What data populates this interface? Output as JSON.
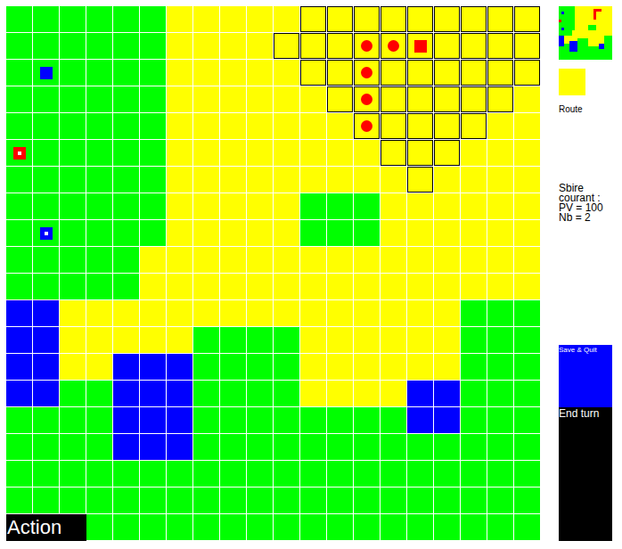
{
  "board": {
    "terrain_colors": {
      "G": "#00ff00",
      "Y": "#ffff00",
      "B": "#0000ff"
    },
    "rows": [
      "GGGGGGYYYYYYYYYYYYYY",
      "GGGGGGYYYYYYYYYYYYYY",
      "GGGGGGYYYYYYYYYYYYYY",
      "GGGGGGYYYYYYYYYYYYYY",
      "GGGGGGYYYYYYYYYYYYYY",
      "GGGGGGYYYYYYYYYYYYYY",
      "GGGGGGYYYYYYYYYYYYYY",
      "GGGGGGYYYYYGGGYYYYYY",
      "GGGGGGYYYYYGGGYYYYYY",
      "GGGGGYYYYYYYYYYYYYYY",
      "GGGGGYYYYYYYYYYYYYYY",
      "BBYYYYYYYYYYYYYYYGGG",
      "BBYYYYYGGGGYYYYYYGGG",
      "BBYYBBBGGGGYYYYYYGGG",
      "BBGGBBBGGGGYYYYBBGGG",
      "GGGGBBBGGGGGGGGBBGGG",
      "GGGGBBBGGGGGGGGGGGGG",
      "GGGGGGGGGGGGGGGGGGGG",
      "GGGGGGGGGGGGGGGGGGGG",
      "GGGGGGGGGGGGGGGGGGGG"
    ],
    "range": [
      {
        "row": 0,
        "from": 11,
        "to": 19
      },
      {
        "row": 1,
        "from": 10,
        "to": 19
      },
      {
        "row": 2,
        "from": 11,
        "to": 19
      },
      {
        "row": 3,
        "from": 12,
        "to": 18
      },
      {
        "row": 4,
        "from": 13,
        "to": 17
      },
      {
        "row": 5,
        "from": 14,
        "to": 16
      },
      {
        "row": 6,
        "from": 15,
        "to": 15
      }
    ],
    "units": [
      {
        "row": 2,
        "col": 1,
        "kind": "square",
        "color": "#0000ff",
        "marked": false
      },
      {
        "row": 5,
        "col": 0,
        "kind": "square",
        "color": "#ff0000",
        "marked": true
      },
      {
        "row": 8,
        "col": 1,
        "kind": "square",
        "color": "#0000ff",
        "marked": true
      },
      {
        "row": 1,
        "col": 13,
        "kind": "circle",
        "color": "#ff0000",
        "marked": false
      },
      {
        "row": 1,
        "col": 14,
        "kind": "circle",
        "color": "#ff0000",
        "marked": false
      },
      {
        "row": 1,
        "col": 15,
        "kind": "square",
        "color": "#ff0000",
        "marked": false
      },
      {
        "row": 2,
        "col": 13,
        "kind": "circle",
        "color": "#ff0000",
        "marked": false
      },
      {
        "row": 3,
        "col": 13,
        "kind": "circle",
        "color": "#ff0000",
        "marked": false
      },
      {
        "row": 4,
        "col": 13,
        "kind": "circle",
        "color": "#ff0000",
        "marked": false
      }
    ]
  },
  "action_button": "Action",
  "selected_terrain": {
    "label": "Route",
    "color": "#ffff00"
  },
  "unit_info": {
    "title": "Sbire courant :",
    "lines": [
      "PV = 100",
      "Nb = 2"
    ]
  },
  "buttons": [
    {
      "label": "Save & Quit",
      "kind": "save"
    },
    {
      "label": "End turn",
      "kind": "end"
    }
  ]
}
